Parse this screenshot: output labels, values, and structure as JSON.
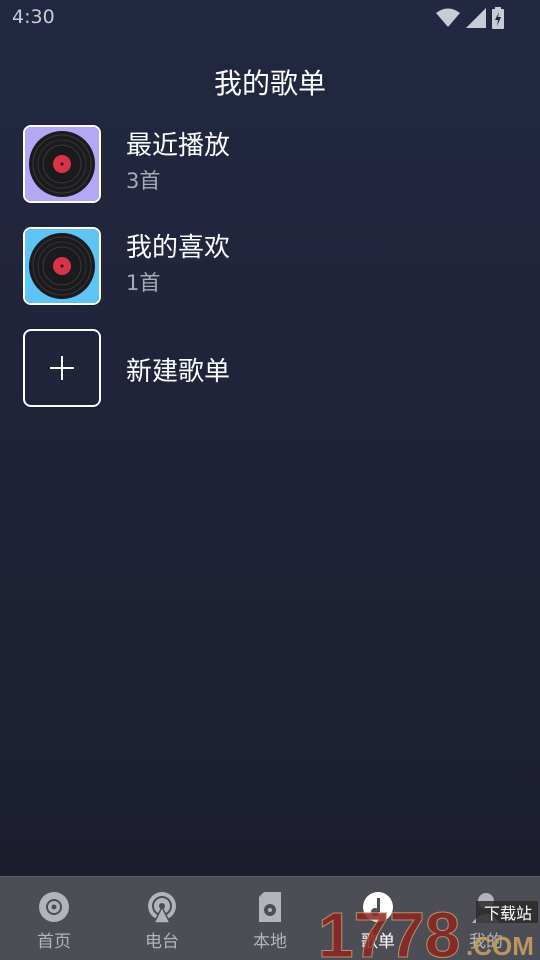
{
  "status_bar": {
    "time": "4:30"
  },
  "header": {
    "title": "我的歌单"
  },
  "playlists": [
    {
      "name": "最近播放",
      "count": "3首",
      "cover_bg": "#b4a8f6"
    },
    {
      "name": "我的喜欢",
      "count": "1首",
      "cover_bg": "#5ec3f5"
    }
  ],
  "new_playlist": {
    "label": "新建歌单"
  },
  "bottom_nav": {
    "items": [
      {
        "label": "首页",
        "icon": "disc-icon"
      },
      {
        "label": "电台",
        "icon": "radio-icon"
      },
      {
        "label": "本地",
        "icon": "sd-card-icon"
      },
      {
        "label": "歌单",
        "icon": "playlist-icon",
        "active": true
      },
      {
        "label": "我的",
        "icon": "user-icon"
      }
    ]
  },
  "watermark": {
    "brand": "1778",
    "tag": "下载站",
    "domain": ".COM"
  }
}
